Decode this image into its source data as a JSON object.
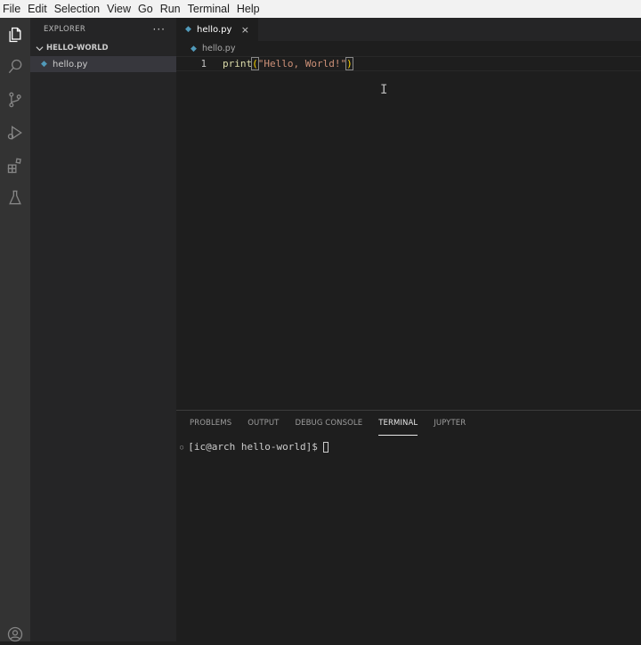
{
  "menubar": {
    "items": [
      "File",
      "Edit",
      "Selection",
      "View",
      "Go",
      "Run",
      "Terminal",
      "Help"
    ]
  },
  "activitybar": {
    "icons": [
      "explorer-icon",
      "search-icon",
      "source-control-icon",
      "run-debug-icon",
      "extensions-icon",
      "testing-icon",
      "account-icon"
    ]
  },
  "sidebar": {
    "title": "EXPLORER",
    "more_actions": "···",
    "folder": "HELLO-WORLD",
    "files": [
      "hello.py"
    ]
  },
  "editor": {
    "tab_label": "hello.py",
    "tab_close": "×",
    "breadcrumb": "hello.py",
    "line_number": "1",
    "code": {
      "fn": "print",
      "open_paren": "(",
      "string": "\"Hello, World!\"",
      "close_paren": ")"
    },
    "mouse_cursor": "I"
  },
  "panel": {
    "tabs": [
      "PROBLEMS",
      "OUTPUT",
      "DEBUG CONSOLE",
      "TERMINAL",
      "JUPYTER"
    ],
    "active_tab": "TERMINAL",
    "terminal_prompt": "[ic@arch hello-world]$"
  },
  "colors": {
    "python_icon": "#519aba",
    "string": "#ce9178",
    "function": "#dcdcaa",
    "bracket": "#ffd700"
  }
}
